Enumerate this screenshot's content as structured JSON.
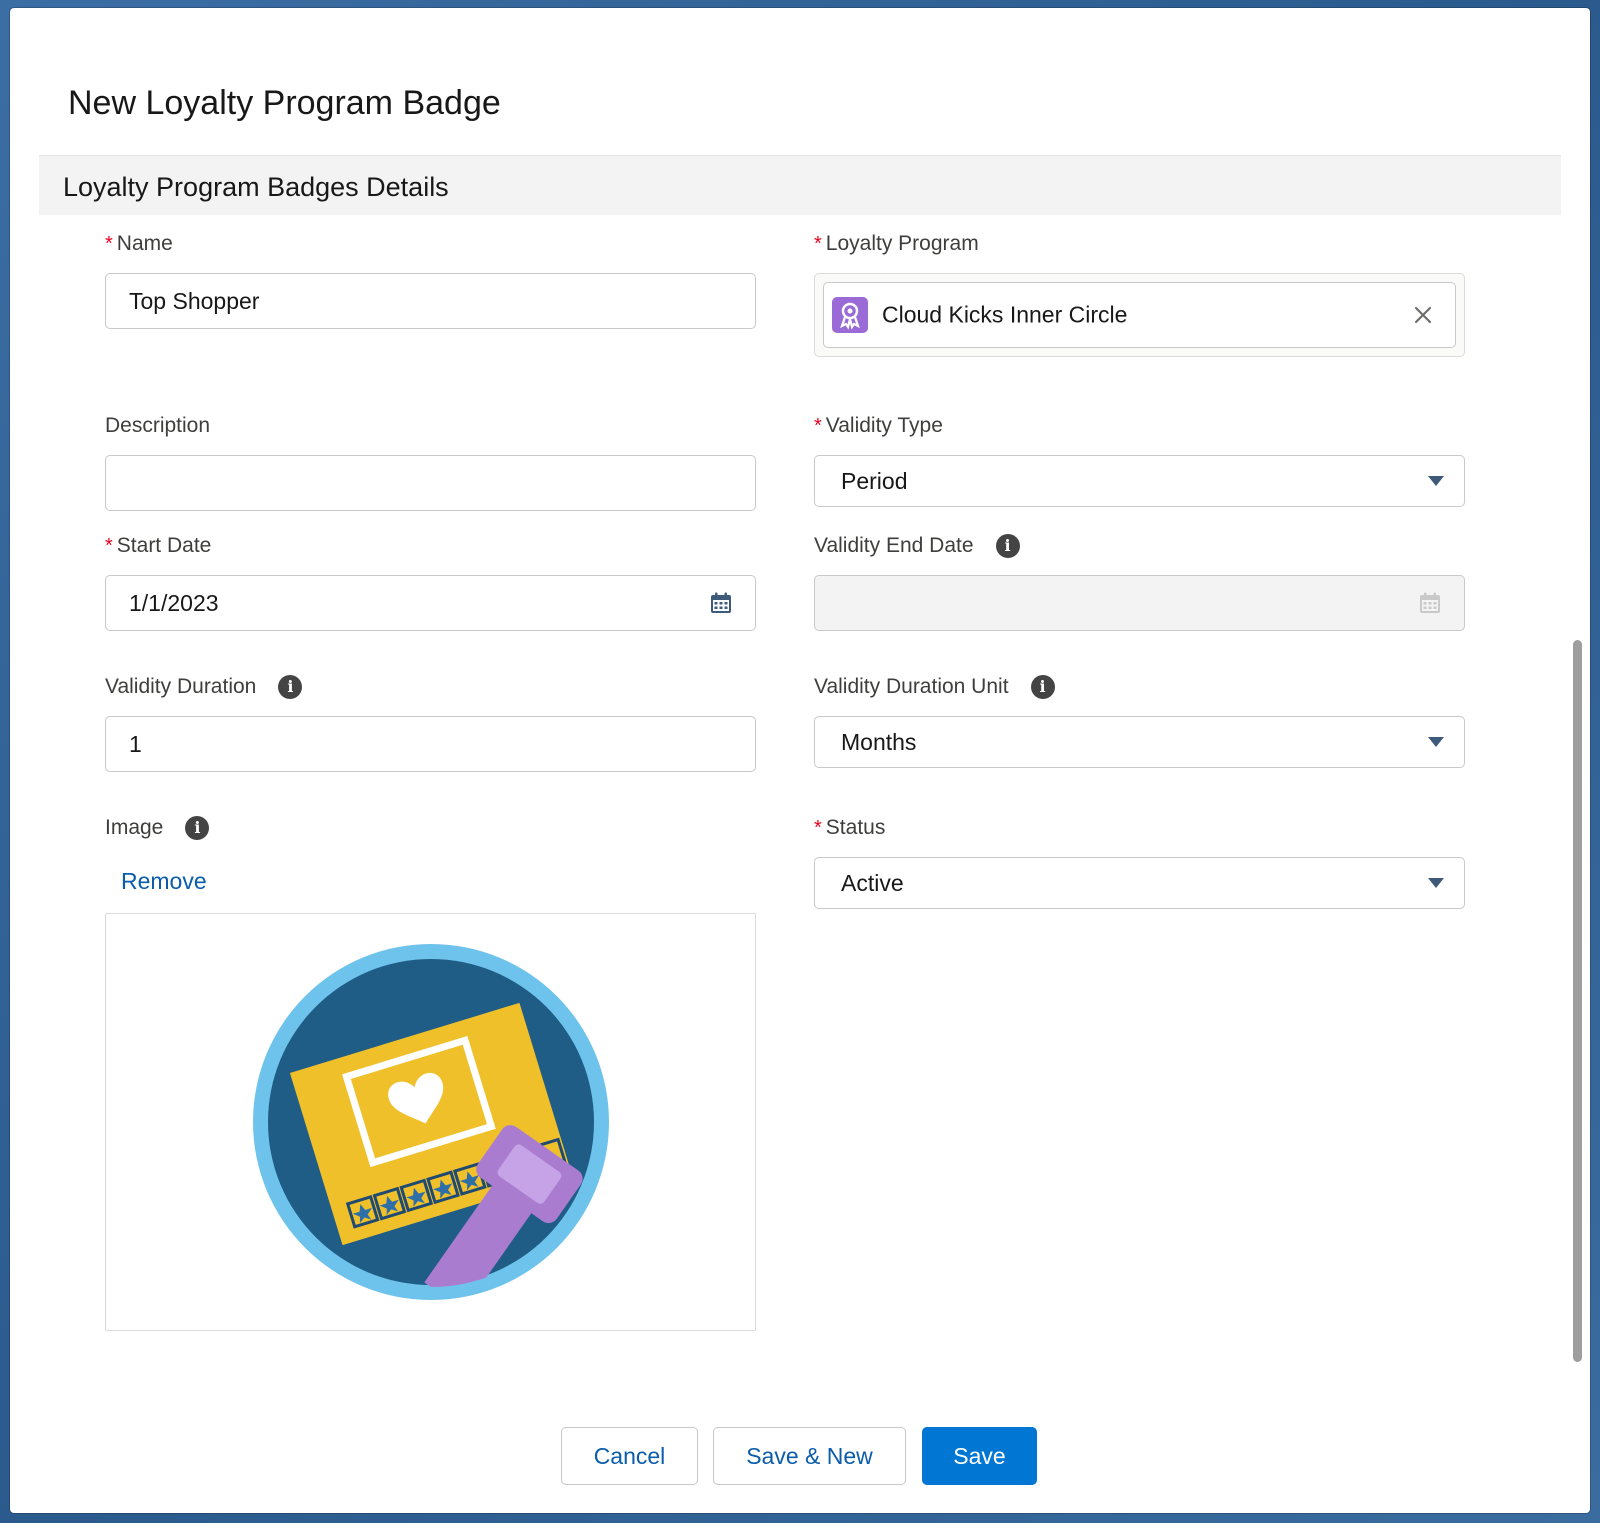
{
  "modal": {
    "title": "New Loyalty Program Badge",
    "section_title": "Loyalty Program Badges Details"
  },
  "fields": {
    "name": {
      "label": "Name",
      "required": true,
      "value": "Top Shopper"
    },
    "loyalty_program": {
      "label": "Loyalty Program",
      "required": true,
      "value": "Cloud Kicks Inner Circle",
      "icon": "loyalty-program-icon"
    },
    "description": {
      "label": "Description",
      "required": false,
      "value": ""
    },
    "validity_type": {
      "label": "Validity Type",
      "required": true,
      "value": "Period"
    },
    "start_date": {
      "label": "Start Date",
      "required": true,
      "value": "1/1/2023"
    },
    "validity_end_date": {
      "label": "Validity End Date",
      "required": false,
      "value": "",
      "disabled": true
    },
    "validity_duration": {
      "label": "Validity Duration",
      "required": false,
      "value": "1"
    },
    "validity_duration_unit": {
      "label": "Validity Duration Unit",
      "required": false,
      "value": "Months"
    },
    "image": {
      "label": "Image",
      "remove_label": "Remove"
    },
    "status": {
      "label": "Status",
      "required": true,
      "value": "Active"
    }
  },
  "footer": {
    "cancel_label": "Cancel",
    "save_new_label": "Save & New",
    "save_label": "Save"
  },
  "colors": {
    "brand": "#0176d3",
    "link": "#0b5cab",
    "required": "#ea001e",
    "badge_ring": "#6ec3ec",
    "badge_bg": "#1f5d86",
    "card": "#f0c02a",
    "stamp": "#a97cd0"
  }
}
